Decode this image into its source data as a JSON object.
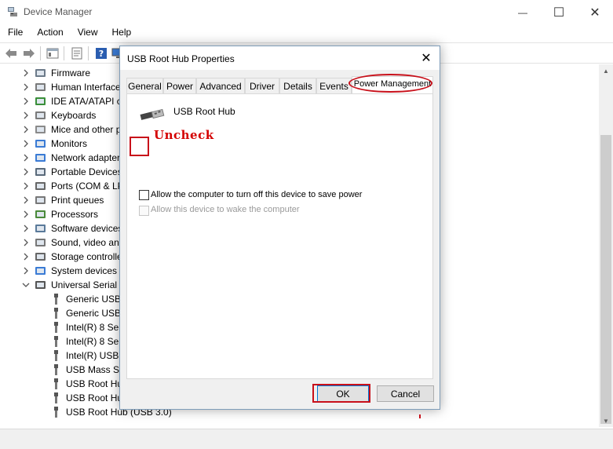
{
  "window": {
    "title": "Device Manager",
    "minimize": "—",
    "maximize": "☐",
    "close": "✕"
  },
  "menu": [
    "File",
    "Action",
    "View",
    "Help"
  ],
  "tree": {
    "categories": [
      {
        "label": "Firmware",
        "icon": "firmware-icon"
      },
      {
        "label": "Human Interface",
        "icon": "hid-icon"
      },
      {
        "label": "IDE ATA/ATAPI c",
        "icon": "ide-icon"
      },
      {
        "label": "Keyboards",
        "icon": "keyboard-icon"
      },
      {
        "label": "Mice and other p",
        "icon": "mouse-icon"
      },
      {
        "label": "Monitors",
        "icon": "monitor-icon"
      },
      {
        "label": "Network adapter",
        "icon": "network-icon"
      },
      {
        "label": "Portable Devices",
        "icon": "portable-icon"
      },
      {
        "label": "Ports (COM & LP",
        "icon": "port-icon"
      },
      {
        "label": "Print queues",
        "icon": "printer-icon"
      },
      {
        "label": "Processors",
        "icon": "processor-icon"
      },
      {
        "label": "Software devices",
        "icon": "software-icon"
      },
      {
        "label": "Sound, video and",
        "icon": "sound-icon"
      },
      {
        "label": "Storage controlle",
        "icon": "storage-icon"
      },
      {
        "label": "System devices",
        "icon": "system-icon"
      },
      {
        "label": "Universal Serial B",
        "icon": "usb-icon"
      }
    ],
    "usb_children": [
      "Generic USB",
      "Generic USB",
      "Intel(R) 8 Seri",
      "Intel(R) 8 Seri",
      "Intel(R) USB 3",
      "USB Mass Sto",
      "USB Root Hu",
      "USB Root Hu",
      "USB Root Hub (USB 3.0)"
    ]
  },
  "dialog": {
    "title": "USB Root Hub Properties",
    "close": "✕",
    "tabs": [
      "General",
      "Power",
      "Advanced",
      "Driver",
      "Details",
      "Events",
      "Power Management"
    ],
    "active_tab": "Power Management",
    "device_name": "USB Root Hub",
    "option_allow_off": "Allow the computer to turn off this device to save power",
    "option_allow_off_checked": false,
    "option_wake": "Allow this device to wake the computer",
    "option_wake_enabled": false,
    "ok_label": "OK",
    "cancel_label": "Cancel"
  },
  "annotation": {
    "text": "Uncheck",
    "color": "#c8101a"
  }
}
